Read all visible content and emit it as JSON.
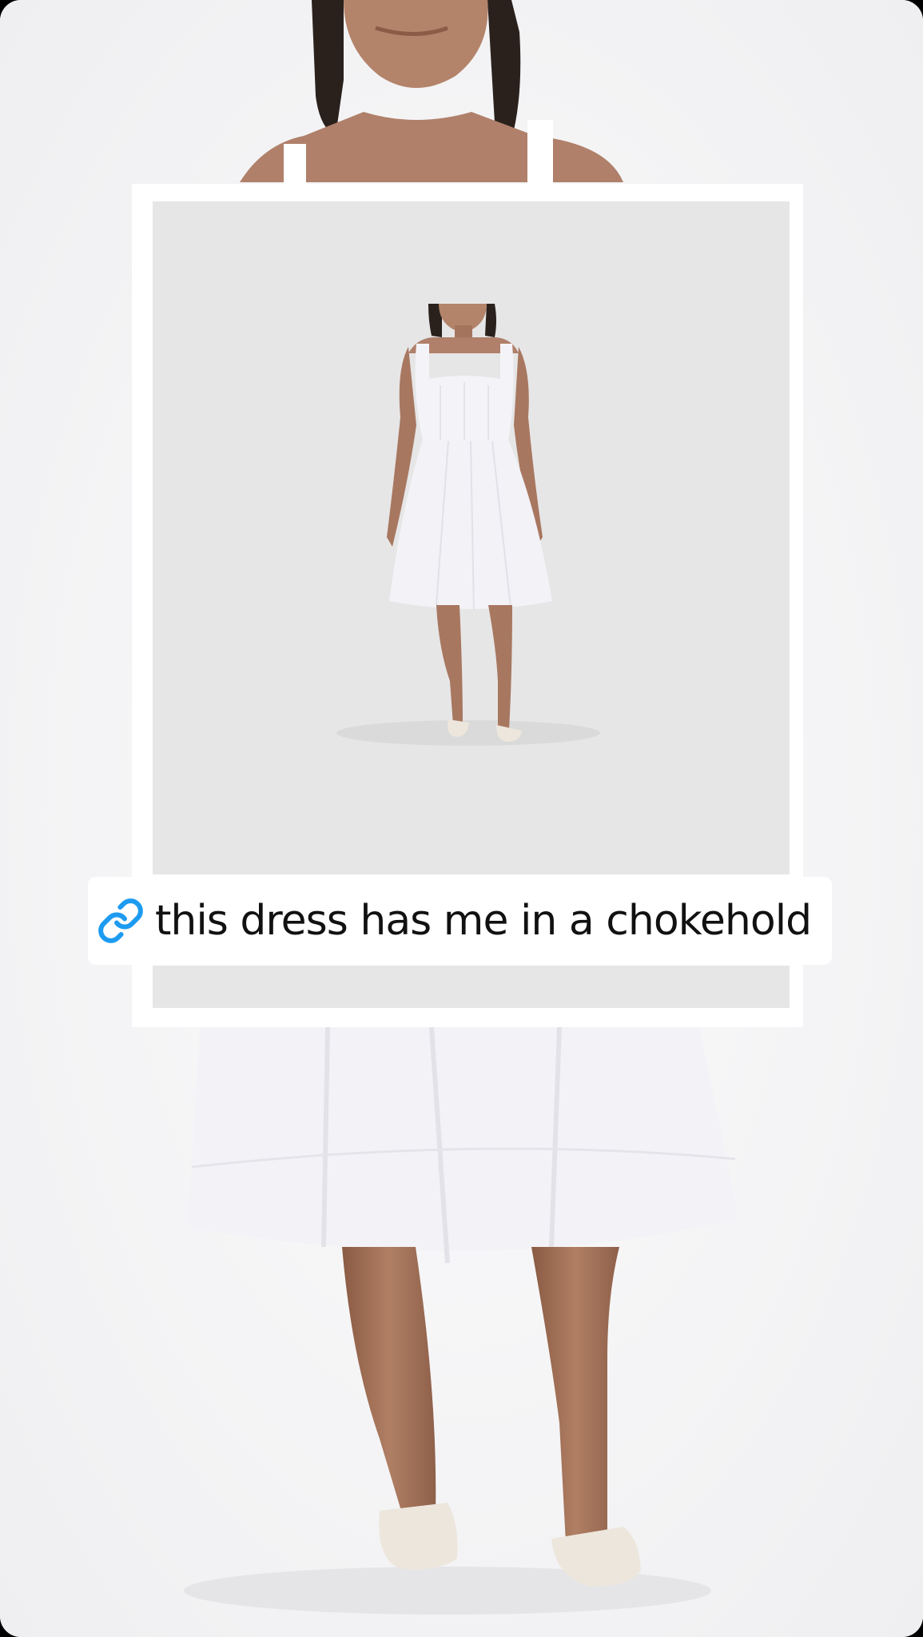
{
  "story": {
    "link_sticker": {
      "icon": "link-icon",
      "text": "this dress has me in a chokehold",
      "icon_color": "#1d9bf0"
    },
    "product_photo": {
      "subject": "white midi sundress",
      "background_color": "#e6e6e6"
    },
    "colors": {
      "dress": "#f3f3f6",
      "skin": "#a9785e",
      "hair": "#2a211d",
      "sandal": "#ede6dd"
    }
  }
}
